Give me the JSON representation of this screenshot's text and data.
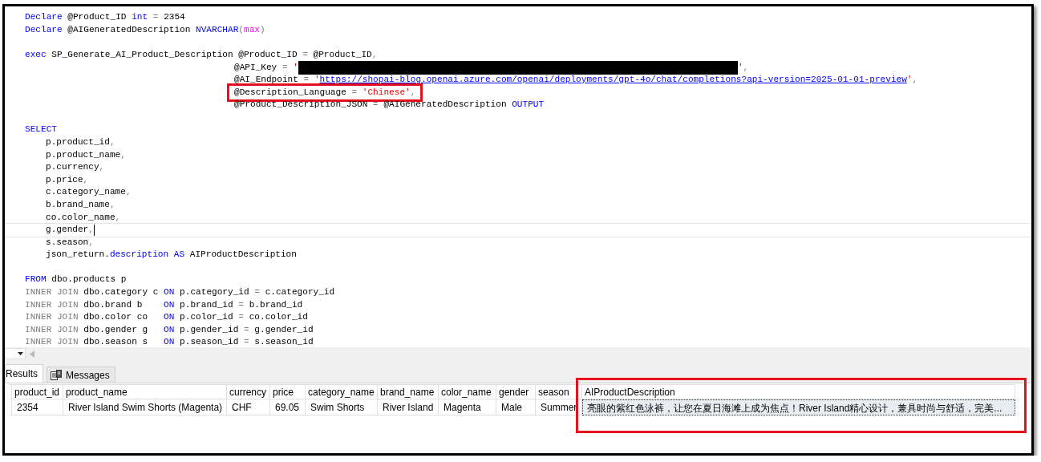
{
  "editor": {
    "lines": [
      {
        "kind": "top",
        "current": false,
        "tokens": [
          {
            "kind": "kw",
            "text": "Declare"
          },
          {
            "kind": "txt",
            "text": " @Product_ID "
          },
          {
            "kind": "kw",
            "text": "int"
          },
          {
            "kind": "op",
            "text": " = "
          },
          {
            "kind": "txt",
            "text": "2354"
          }
        ]
      },
      {
        "kind": "top",
        "current": false,
        "tokens": [
          {
            "kind": "kw",
            "text": "Declare"
          },
          {
            "kind": "txt",
            "text": " @AIGeneratedDescription "
          },
          {
            "kind": "kw",
            "text": "NVARCHAR"
          },
          {
            "kind": "op",
            "text": "("
          },
          {
            "kind": "fn",
            "text": "max"
          },
          {
            "kind": "op",
            "text": ")"
          }
        ]
      },
      {
        "kind": "top",
        "current": false
      },
      {
        "kind": "top",
        "current": false,
        "tokens": [
          {
            "kind": "kw",
            "text": "exec"
          },
          {
            "kind": "txt",
            "text": " SP_Generate_AI_Product_Description @Product_ID "
          },
          {
            "kind": "op",
            "text": "="
          },
          {
            "kind": "txt",
            "text": " @Product_ID"
          },
          {
            "kind": "op",
            "text": ","
          }
        ]
      },
      {
        "kind": "param",
        "current": false,
        "tokens": [
          {
            "kind": "txt",
            "text": "@API_Key "
          },
          {
            "kind": "op",
            "text": "="
          },
          {
            "kind": "str",
            "text": " '"
          },
          {
            "kind": "redaction"
          },
          {
            "kind": "str",
            "text": "'"
          },
          {
            "kind": "op",
            "text": ","
          }
        ]
      },
      {
        "kind": "param",
        "current": false,
        "tokens": [
          {
            "kind": "txt",
            "text": "@AI_Endpoint "
          },
          {
            "kind": "op",
            "text": "="
          },
          {
            "kind": "str",
            "text": " '"
          },
          {
            "kind": "url",
            "text": "https://shopai-blog.openai.azure.com/openai/deployments/gpt-4o/chat/completions?api-version=2025-01-01-preview"
          },
          {
            "kind": "str",
            "text": "'"
          },
          {
            "kind": "op",
            "text": ","
          }
        ]
      },
      {
        "kind": "param",
        "current": false,
        "highlight": true,
        "tokens": [
          {
            "kind": "txt",
            "text": "@Description_Language "
          },
          {
            "kind": "op",
            "text": "="
          },
          {
            "kind": "str",
            "text": " 'Chinese'"
          },
          {
            "kind": "op",
            "text": ","
          }
        ]
      },
      {
        "kind": "param",
        "current": false,
        "tokens": [
          {
            "kind": "txt",
            "text": "@Product_Description_JSON "
          },
          {
            "kind": "op",
            "text": "="
          },
          {
            "kind": "txt",
            "text": " @AIGeneratedDescription "
          },
          {
            "kind": "kw",
            "text": "OUTPUT"
          }
        ]
      },
      {
        "kind": "top",
        "current": false
      },
      {
        "kind": "top",
        "current": false,
        "tokens": [
          {
            "kind": "kw",
            "text": "SELECT"
          }
        ]
      },
      {
        "kind": "field",
        "current": false,
        "tokens": [
          {
            "kind": "txt",
            "text": "p.product_id"
          },
          {
            "kind": "op",
            "text": ","
          }
        ]
      },
      {
        "kind": "field",
        "current": false,
        "tokens": [
          {
            "kind": "txt",
            "text": "p.product_name"
          },
          {
            "kind": "op",
            "text": ","
          }
        ]
      },
      {
        "kind": "field",
        "current": false,
        "tokens": [
          {
            "kind": "txt",
            "text": "p.currency"
          },
          {
            "kind": "op",
            "text": ","
          }
        ]
      },
      {
        "kind": "field",
        "current": false,
        "tokens": [
          {
            "kind": "txt",
            "text": "p.price"
          },
          {
            "kind": "op",
            "text": ","
          }
        ]
      },
      {
        "kind": "field",
        "current": false,
        "tokens": [
          {
            "kind": "txt",
            "text": "c.category_name"
          },
          {
            "kind": "op",
            "text": ","
          }
        ]
      },
      {
        "kind": "field",
        "current": false,
        "tokens": [
          {
            "kind": "txt",
            "text": "b.brand_name"
          },
          {
            "kind": "op",
            "text": ","
          }
        ]
      },
      {
        "kind": "field",
        "current": false,
        "tokens": [
          {
            "kind": "txt",
            "text": "co.color_name"
          },
          {
            "kind": "op",
            "text": ","
          }
        ]
      },
      {
        "kind": "field",
        "current": true,
        "tokens": [
          {
            "kind": "txt",
            "text": "g.gender"
          },
          {
            "kind": "op",
            "text": ","
          }
        ]
      },
      {
        "kind": "field",
        "current": false,
        "tokens": [
          {
            "kind": "txt",
            "text": "s.season"
          },
          {
            "kind": "op",
            "text": ","
          }
        ]
      },
      {
        "kind": "field",
        "current": false,
        "tokens": [
          {
            "kind": "txt",
            "text": "json_return."
          },
          {
            "kind": "kw",
            "text": "description"
          },
          {
            "kind": "kw",
            "text": " AS"
          },
          {
            "kind": "txt",
            "text": " AIProductDescription"
          }
        ]
      },
      {
        "kind": "top",
        "current": false
      },
      {
        "kind": "top",
        "current": false,
        "tokens": [
          {
            "kind": "kw",
            "text": "FROM"
          },
          {
            "kind": "txt",
            "text": " dbo.products p"
          }
        ]
      },
      {
        "kind": "top",
        "current": false,
        "tokens": [
          {
            "kind": "op",
            "text": "INNER JOIN"
          },
          {
            "kind": "txt",
            "text": " dbo.category c "
          },
          {
            "kind": "kw",
            "text": "ON"
          },
          {
            "kind": "txt",
            "text": " p.category_id "
          },
          {
            "kind": "op",
            "text": "="
          },
          {
            "kind": "txt",
            "text": " c.category_id"
          }
        ]
      },
      {
        "kind": "top",
        "current": false,
        "tokens": [
          {
            "kind": "op",
            "text": "INNER JOIN"
          },
          {
            "kind": "txt",
            "text": " dbo.brand b    "
          },
          {
            "kind": "kw",
            "text": "ON"
          },
          {
            "kind": "txt",
            "text": " p.brand_id "
          },
          {
            "kind": "op",
            "text": "="
          },
          {
            "kind": "txt",
            "text": " b.brand_id"
          }
        ]
      },
      {
        "kind": "top",
        "current": false,
        "tokens": [
          {
            "kind": "op",
            "text": "INNER JOIN"
          },
          {
            "kind": "txt",
            "text": " dbo.color co   "
          },
          {
            "kind": "kw",
            "text": "ON"
          },
          {
            "kind": "txt",
            "text": " p.color_id "
          },
          {
            "kind": "op",
            "text": "="
          },
          {
            "kind": "txt",
            "text": " co.color_id"
          }
        ]
      },
      {
        "kind": "top",
        "current": false,
        "tokens": [
          {
            "kind": "op",
            "text": "INNER JOIN"
          },
          {
            "kind": "txt",
            "text": " dbo.gender g   "
          },
          {
            "kind": "kw",
            "text": "ON"
          },
          {
            "kind": "txt",
            "text": " p.gender_id "
          },
          {
            "kind": "op",
            "text": "="
          },
          {
            "kind": "txt",
            "text": " g.gender_id"
          }
        ]
      },
      {
        "kind": "top",
        "current": false,
        "tokens": [
          {
            "kind": "op",
            "text": "INNER JOIN"
          },
          {
            "kind": "txt",
            "text": " dbo.season s   "
          },
          {
            "kind": "kw",
            "text": "ON"
          },
          {
            "kind": "txt",
            "text": " p.season_id "
          },
          {
            "kind": "op",
            "text": "="
          },
          {
            "kind": "txt",
            "text": " s.season_id"
          }
        ]
      }
    ]
  },
  "tabs": [
    {
      "label": "Results",
      "selected": true,
      "icon": false
    },
    {
      "label": "Messages",
      "selected": false,
      "icon": true
    }
  ],
  "table": {
    "columns": [
      {
        "label": "product_id",
        "highlight": false
      },
      {
        "label": "product_name",
        "highlight": false
      },
      {
        "label": "currency",
        "highlight": false
      },
      {
        "label": "price",
        "highlight": false
      },
      {
        "label": "category_name",
        "highlight": false
      },
      {
        "label": "brand_name",
        "highlight": false
      },
      {
        "label": "color_name",
        "highlight": false
      },
      {
        "label": "gender",
        "highlight": false
      },
      {
        "label": "season",
        "highlight": false
      },
      {
        "label": "AIProductDescription",
        "highlight": true
      }
    ],
    "rows": [
      {
        "cells": [
          {
            "text": "2354",
            "selected": false
          },
          {
            "text": "River Island Swim Shorts (Magenta)",
            "selected": false
          },
          {
            "text": "CHF",
            "selected": false
          },
          {
            "text": "69.05",
            "selected": false
          },
          {
            "text": "Swim Shorts",
            "selected": false
          },
          {
            "text": "River Island",
            "selected": false
          },
          {
            "text": "Magenta",
            "selected": false
          },
          {
            "text": "Male",
            "selected": false
          },
          {
            "text": "Summer",
            "selected": false
          },
          {
            "text": "亮眼的紫红色泳裤，让您在夏日海滩上成为焦点！River Island精心设计，兼具时尚与舒适，完美...",
            "selected": true
          }
        ]
      }
    ]
  }
}
